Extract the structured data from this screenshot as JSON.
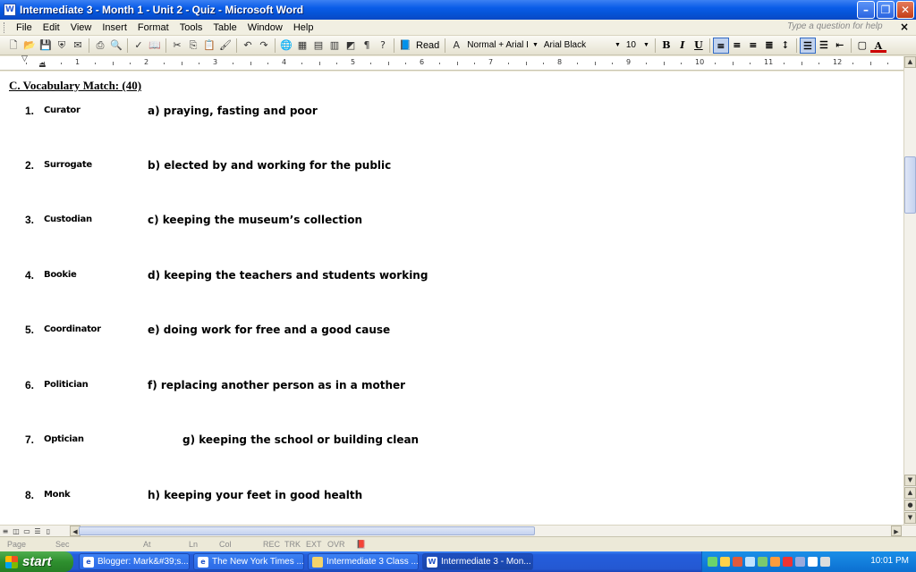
{
  "window": {
    "title": "Intermediate 3 - Month 1 - Unit 2 - Quiz - Microsoft Word"
  },
  "menu": {
    "items": [
      "File",
      "Edit",
      "View",
      "Insert",
      "Format",
      "Tools",
      "Table",
      "Window",
      "Help"
    ],
    "help_placeholder": "Type a question for help"
  },
  "toolbar": {
    "read_label": "Read",
    "style": "Normal + Arial I",
    "font": "Arial Black",
    "size": "10",
    "bold": "B",
    "italic": "I",
    "underline": "U"
  },
  "ruler": {
    "numbers": [
      "1",
      "2",
      "3",
      "4",
      "5",
      "6",
      "7",
      "8",
      "9",
      "10",
      "11",
      "12"
    ]
  },
  "document": {
    "section_title": "C. Vocabulary Match:  (40)",
    "items": [
      {
        "num": "1.",
        "word": "Curator",
        "definition": "a) praying, fasting and poor"
      },
      {
        "num": "2.",
        "word": "Surrogate",
        "definition": "b) elected by and working for the public"
      },
      {
        "num": "3.",
        "word": "Custodian",
        "definition": "c) keeping the museum’s collection"
      },
      {
        "num": "4.",
        "word": "Bookie",
        "definition": "d) keeping the teachers and students working"
      },
      {
        "num": "5.",
        "word": "Coordinator",
        "definition": "e) doing work for free and a good cause"
      },
      {
        "num": "6.",
        "word": "Politician",
        "definition": "f) replacing another person as in a mother"
      },
      {
        "num": "7.",
        "word": "Optician",
        "definition": "g) keeping the school or building clean"
      },
      {
        "num": "8.",
        "word": "Monk",
        "definition": "h) keeping your feet in good health"
      }
    ]
  },
  "status": {
    "page": "Page",
    "sec": "Sec",
    "at": "At",
    "ln": "Ln",
    "col": "Col",
    "rec": "REC",
    "trk": "TRK",
    "ext": "EXT",
    "ovr": "OVR"
  },
  "taskbar": {
    "start": "start",
    "tasks": [
      "Blogger: Mark&#39;s...",
      "The New York Times ...",
      "Intermediate 3 Class ...",
      "Intermediate 3 - Mon..."
    ],
    "clock": "10:01 PM"
  }
}
